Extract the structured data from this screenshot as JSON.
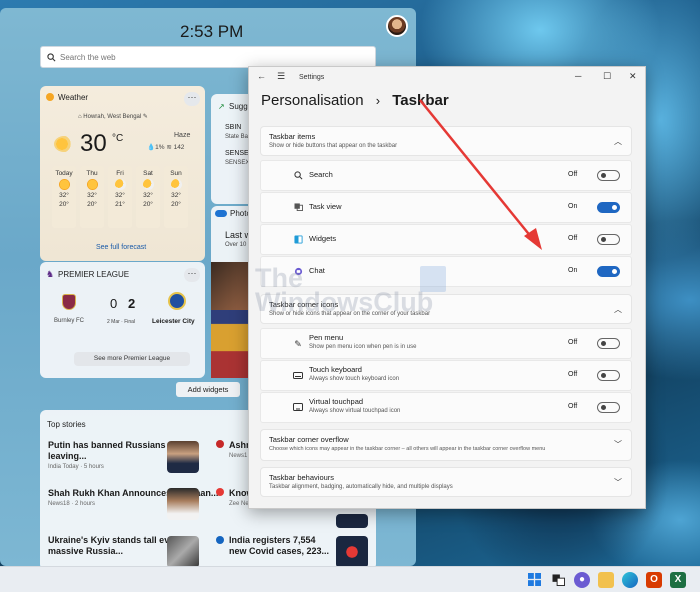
{
  "widgets": {
    "time": "2:53 PM",
    "search_placeholder": "Search the web",
    "weather": {
      "title": "Weather",
      "location": "Howrah, West Bengal",
      "temp": "30",
      "unit": "°C",
      "condition": "Haze",
      "precip": "1%",
      "aqi": "142",
      "forecast": [
        {
          "day": "Today",
          "high": "32°",
          "low": "20°"
        },
        {
          "day": "Thu",
          "high": "32°",
          "low": "20°"
        },
        {
          "day": "Fri",
          "high": "32°",
          "low": "21°"
        },
        {
          "day": "Sat",
          "high": "32°",
          "low": "20°"
        },
        {
          "day": "Sun",
          "high": "32°",
          "low": "20°"
        }
      ],
      "link": "See full forecast"
    },
    "stocks": {
      "title": "Sugge",
      "items": [
        {
          "symbol": "SBIN",
          "name": "State Ba"
        },
        {
          "symbol": "SENSEX",
          "name": "SENSEX"
        }
      ]
    },
    "photos": {
      "title": "Photo",
      "line1": "Last w",
      "line2": "Over 10"
    },
    "sports": {
      "title": "PREMIER LEAGUE",
      "home": "Burnley FC",
      "away": "Leicester City",
      "home_score": "0",
      "away_score": "2",
      "status": "2 Mar · Final",
      "link": "See more Premier League"
    },
    "add_widgets": "Add widgets",
    "top_stories_title": "Top stories",
    "news_left": [
      {
        "title": "Putin has banned Russians from leaving...",
        "source": "India Today · 5 hours"
      },
      {
        "title": "Shah Rukh Khan Announces 'Pathaan...",
        "source": "News18 · 2 hours"
      },
      {
        "title": "Ukraine's Kyiv stands tall even as massive Russia...",
        "source": ""
      }
    ],
    "news_right": [
      {
        "title": "Ashn",
        "source": "News1"
      },
      {
        "title": "Know",
        "source": "Zee News · 5 hours"
      },
      {
        "title": "India registers 7,554 new Covid cases, 223...",
        "source": ""
      }
    ]
  },
  "settings": {
    "window_title": "Settings",
    "breadcrumb_parent": "Personalisation",
    "breadcrumb_separator": "›",
    "breadcrumb_current": "Taskbar",
    "sections": [
      {
        "title": "Taskbar items",
        "subtitle": "Show or hide buttons that appear on the taskbar"
      },
      {
        "title": "Taskbar corner icons",
        "subtitle": "Show or hide icons that appear on the corner of your taskbar"
      },
      {
        "title": "Taskbar corner overflow",
        "subtitle": "Choose which icons may appear in the taskbar corner – all others will appear in the taskbar corner overflow menu"
      },
      {
        "title": "Taskbar behaviours",
        "subtitle": "Taskbar alignment, badging, automatically hide, and multiple displays"
      }
    ],
    "taskbar_items": [
      {
        "label": "Search",
        "state": "Off",
        "icon": "search-icon"
      },
      {
        "label": "Task view",
        "state": "On",
        "icon": "task-view-icon"
      },
      {
        "label": "Widgets",
        "state": "Off",
        "icon": "widgets-icon"
      },
      {
        "label": "Chat",
        "state": "On",
        "icon": "chat-icon"
      }
    ],
    "corner_icons": [
      {
        "label": "Pen menu",
        "sub": "Show pen menu icon when pen is in use",
        "state": "Off",
        "icon": "pen-icon"
      },
      {
        "label": "Touch keyboard",
        "sub": "Always show touch keyboard icon",
        "state": "Off",
        "icon": "keyboard-icon"
      },
      {
        "label": "Virtual touchpad",
        "sub": "Always show virtual touchpad icon",
        "state": "Off",
        "icon": "touchpad-icon"
      }
    ]
  },
  "watermark": {
    "line1": "The",
    "line2": "WindowsClub"
  },
  "colors": {
    "accent": "#1f67c2",
    "arrow": "#e53935"
  }
}
